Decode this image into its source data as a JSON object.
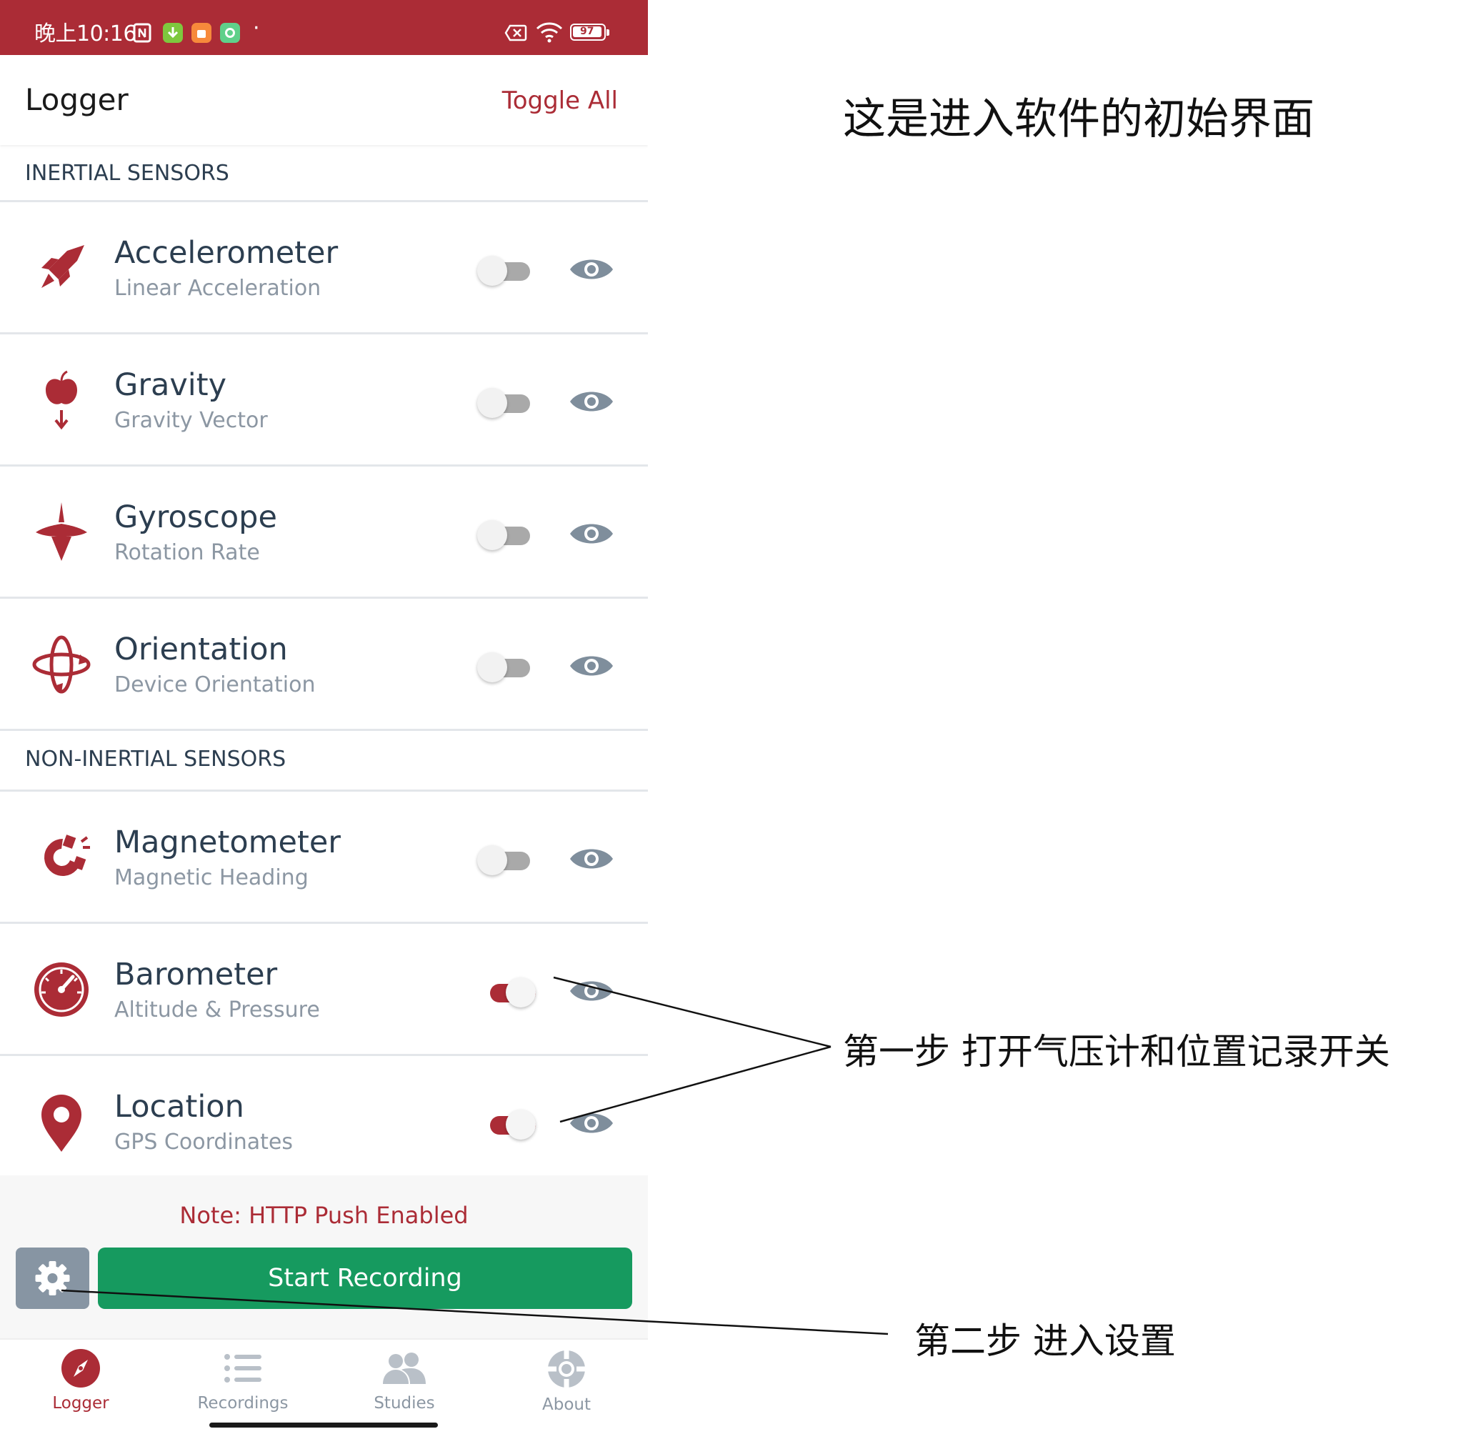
{
  "status_bar": {
    "time": "晚上10:16",
    "battery": "97",
    "dot": "·"
  },
  "header": {
    "title": "Logger",
    "toggle_all": "Toggle All"
  },
  "sections": {
    "inertial": "INERTIAL SENSORS",
    "non_inertial": "NON-INERTIAL SENSORS"
  },
  "sensors": [
    {
      "name": "Accelerometer",
      "subtitle": "Linear Acceleration",
      "icon": "rocket-icon",
      "enabled": false
    },
    {
      "name": "Gravity",
      "subtitle": "Gravity Vector",
      "icon": "apple-icon",
      "enabled": false
    },
    {
      "name": "Gyroscope",
      "subtitle": "Rotation Rate",
      "icon": "spinning-top-icon",
      "enabled": false
    },
    {
      "name": "Orientation",
      "subtitle": "Device Orientation",
      "icon": "orientation-icon",
      "enabled": false
    },
    {
      "name": "Magnetometer",
      "subtitle": "Magnetic Heading",
      "icon": "magnet-icon",
      "enabled": false
    },
    {
      "name": "Barometer",
      "subtitle": "Altitude & Pressure",
      "icon": "gauge-icon",
      "enabled": true
    },
    {
      "name": "Location",
      "subtitle": "GPS Coordinates",
      "icon": "map-pin-icon",
      "enabled": true
    }
  ],
  "bottom": {
    "note": "Note: HTTP Push Enabled",
    "start_recording": "Start Recording"
  },
  "nav": [
    {
      "label": "Logger",
      "icon": "compass-icon",
      "active": true
    },
    {
      "label": "Recordings",
      "icon": "list-icon",
      "active": false
    },
    {
      "label": "Studies",
      "icon": "users-icon",
      "active": false
    },
    {
      "label": "About",
      "icon": "lifebuoy-icon",
      "active": false
    }
  ],
  "annotations": {
    "main": "这是进入软件的初始界面",
    "step1": "第一步 打开气压计和位置记录开关",
    "step2": "第二步 进入设置"
  },
  "colors": {
    "brand_red": "#ab2c36",
    "start_green": "#169a5f",
    "settings_gray": "#8795a3",
    "text_dark": "#2c3e50",
    "text_muted": "#8c97a3"
  }
}
